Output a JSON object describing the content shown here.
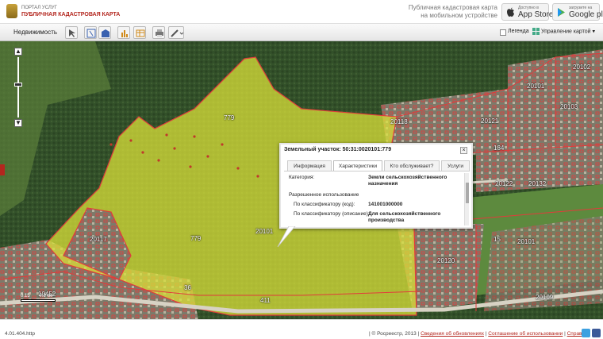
{
  "header": {
    "portal_sub": "ПОРТАЛ УСЛУГ",
    "portal_title": "ПУБЛИЧНАЯ КАДАСТРОВАЯ КАРТА",
    "mobile_line1": "Публичная кадастровая карта",
    "mobile_line2": "на мобильном устройстве",
    "appstore_small": "Доступно в",
    "appstore_big": "App Store",
    "googleplay_small": "загрузите на",
    "googleplay_big": "Google play"
  },
  "toolbar": {
    "realty_select": "Недвижимость ▾",
    "legend_label": "Легенда",
    "map_management": "Управление картой ▾"
  },
  "map": {
    "labels": [
      {
        "id": "779-top",
        "text": "779"
      },
      {
        "id": "779-mid",
        "text": "779"
      },
      {
        "id": "20101",
        "text": "20101"
      },
      {
        "id": "20117",
        "text": "20117"
      },
      {
        "id": "20118",
        "text": "20118"
      },
      {
        "id": "20120",
        "text": "20120"
      },
      {
        "id": "20121",
        "text": "20121"
      },
      {
        "id": "20122",
        "text": "20122"
      },
      {
        "id": "20104-right",
        "text": "20101"
      },
      {
        "id": "20101-tr",
        "text": "20101"
      },
      {
        "id": "20102",
        "text": "20102"
      },
      {
        "id": "20103",
        "text": "20103"
      },
      {
        "id": "20132",
        "text": "20132"
      },
      {
        "id": "134",
        "text": "134"
      },
      {
        "id": "15",
        "text": "15"
      },
      {
        "id": "20109",
        "text": "20109"
      },
      {
        "id": "36",
        "text": "36"
      },
      {
        "id": "411",
        "text": "411"
      },
      {
        "id": "20120-bl",
        "text": "10452"
      }
    ],
    "scale_labels": [
      "0.15",
      "0.3 км"
    ]
  },
  "popup": {
    "title": "Земельный участок: 50:31:0020101:779",
    "close": "×",
    "tabs": [
      "Информация",
      "Характеристики",
      "Кто обслуживает?",
      "Услуги"
    ],
    "active_tab": "Характеристики",
    "rows": {
      "category_label": "Категория:",
      "category_value_1": "Земли сельскохозяйственного",
      "category_value_2": "назначения",
      "permitted_use": "Разрешенное использование",
      "code_label": "По классификатору (код):",
      "code_value": "141001000000",
      "desc_label": "По классификатору (описание):",
      "desc_value_1": "Для сельскохозяйственного",
      "desc_value_2": "производства"
    }
  },
  "footer": {
    "version": "4.01.404.http",
    "copyright": "| © Росреестр, 2013 |",
    "link_updates": "Сведения об обновлениях",
    "link_agreement": "Соглашение об использовании",
    "link_help": "Справка",
    "sep": "|"
  },
  "colors": {
    "accent_red": "#b3261e",
    "plot_yellow": "#d9e03a",
    "cadastre_line": "#e23b3b"
  }
}
